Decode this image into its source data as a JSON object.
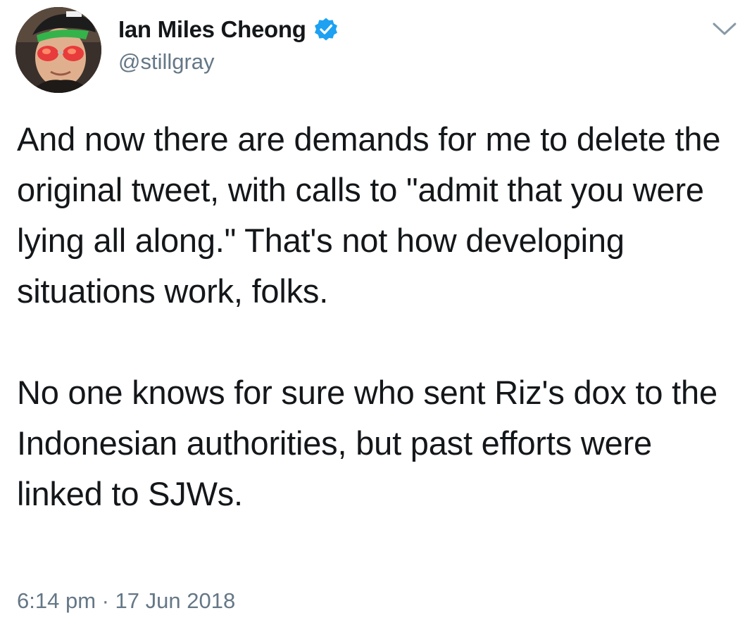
{
  "user": {
    "display_name": "Ian Miles Cheong",
    "handle": "@stillgray",
    "verified": true,
    "avatar_icon": "profile-photo-man-with-green-cap-and-red-sunglasses"
  },
  "menu": {
    "icon": "chevron-down-icon"
  },
  "tweet": {
    "paragraphs": [
      "And now there are demands for me to delete the original tweet, with calls to \"admit that you were lying all along.\" That's not how developing situations work, folks.",
      "No one knows for sure who sent Riz's dox to the Indonesian authorities, but past efforts were linked to SJWs."
    ],
    "timestamp": "6:14 pm · 17 Jun 2018"
  },
  "colors": {
    "text_primary": "#14171a",
    "text_secondary": "#657786",
    "verified_blue": "#1da1f2",
    "background": "#ffffff"
  }
}
